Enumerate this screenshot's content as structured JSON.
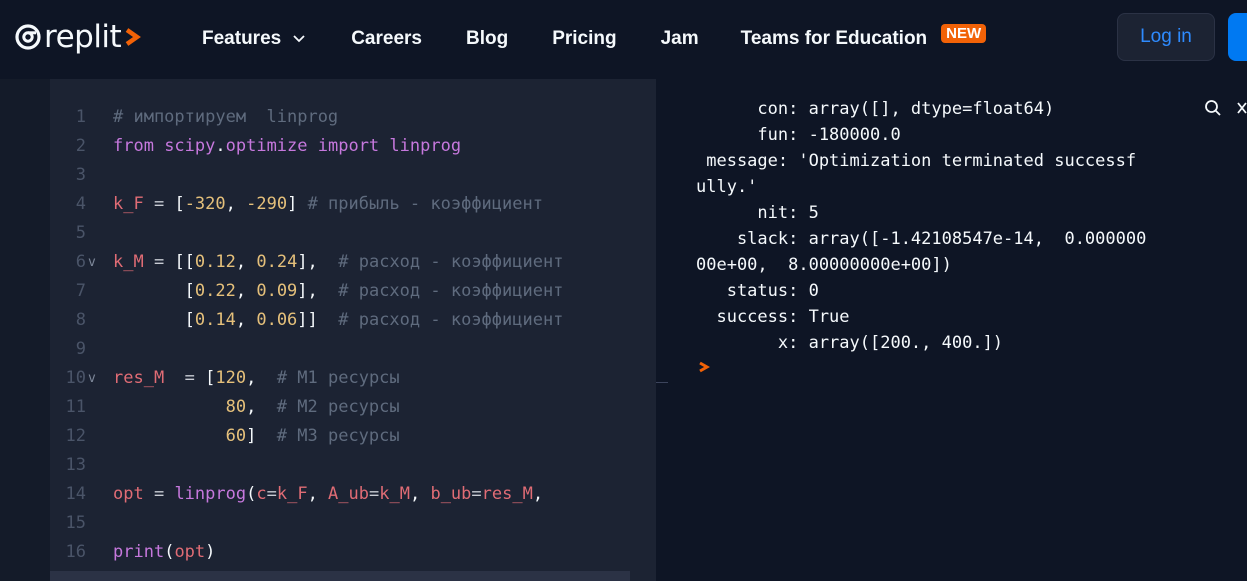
{
  "brand": {
    "name": "replit",
    "colors": {
      "accent_orange": "#f26207",
      "link_blue": "#2e8bff",
      "primary_blue": "#0079f2",
      "bg": "#0e1525"
    }
  },
  "nav": {
    "links": [
      "Features",
      "Careers",
      "Blog",
      "Pricing",
      "Jam",
      "Teams for Education"
    ],
    "badge": "NEW",
    "login": "Log in"
  },
  "editor": {
    "line_numbers": [
      "1",
      "2",
      "3",
      "4",
      "5",
      "6",
      "7",
      "8",
      "9",
      "10",
      "11",
      "12",
      "13",
      "14",
      "15",
      "16"
    ],
    "lines": [
      [
        [
          "com",
          "# импортируем  linprog"
        ]
      ],
      [
        [
          "kw",
          "from "
        ],
        [
          "mod",
          "scipy"
        ],
        [
          "pun",
          "."
        ],
        [
          "mod",
          "optimize"
        ],
        [
          "kw",
          " import "
        ],
        [
          "mod",
          "linprog"
        ]
      ],
      [],
      [
        [
          "var",
          "k_F"
        ],
        [
          "op",
          " = "
        ],
        [
          "pun",
          "["
        ],
        [
          "num",
          "-320"
        ],
        [
          "pun",
          ", "
        ],
        [
          "num",
          "-290"
        ],
        [
          "pun",
          "]"
        ],
        [
          "com",
          " # прибыль - коэффициент"
        ]
      ],
      [],
      [
        [
          "var",
          "k_M"
        ],
        [
          "op",
          " = "
        ],
        [
          "pun",
          "[["
        ],
        [
          "num",
          "0.12"
        ],
        [
          "pun",
          ", "
        ],
        [
          "num",
          "0.24"
        ],
        [
          "pun",
          "],"
        ],
        [
          "com",
          "  # расход - коэффициент"
        ]
      ],
      [
        [
          "plain",
          "       "
        ],
        [
          "pun",
          "["
        ],
        [
          "num",
          "0.22"
        ],
        [
          "pun",
          ", "
        ],
        [
          "num",
          "0.09"
        ],
        [
          "pun",
          "],"
        ],
        [
          "com",
          "  # расход - коэффициент"
        ]
      ],
      [
        [
          "plain",
          "       "
        ],
        [
          "pun",
          "["
        ],
        [
          "num",
          "0.14"
        ],
        [
          "pun",
          ", "
        ],
        [
          "num",
          "0.06"
        ],
        [
          "pun",
          "]]"
        ],
        [
          "com",
          "  # расход - коэффициент"
        ]
      ],
      [],
      [
        [
          "var",
          "res_M"
        ],
        [
          "op",
          "  = "
        ],
        [
          "pun",
          "["
        ],
        [
          "num",
          "120"
        ],
        [
          "pun",
          ","
        ],
        [
          "com",
          "  # M1 ресурсы"
        ]
      ],
      [
        [
          "plain",
          "           "
        ],
        [
          "num",
          "80"
        ],
        [
          "pun",
          ","
        ],
        [
          "com",
          "  # M2 ресурсы"
        ]
      ],
      [
        [
          "plain",
          "           "
        ],
        [
          "num",
          "60"
        ],
        [
          "pun",
          "]"
        ],
        [
          "com",
          "  # M3 ресурсы"
        ]
      ],
      [],
      [
        [
          "var",
          "opt"
        ],
        [
          "op",
          " = "
        ],
        [
          "fn",
          "linprog"
        ],
        [
          "pun",
          "("
        ],
        [
          "attr",
          "c"
        ],
        [
          "op",
          "="
        ],
        [
          "var",
          "k_F"
        ],
        [
          "pun",
          ", "
        ],
        [
          "attr",
          "A_ub"
        ],
        [
          "op",
          "="
        ],
        [
          "var",
          "k_M"
        ],
        [
          "pun",
          ", "
        ],
        [
          "attr",
          "b_ub"
        ],
        [
          "op",
          "="
        ],
        [
          "var",
          "res_M"
        ],
        [
          "pun",
          ","
        ]
      ],
      [],
      [
        [
          "fn",
          "print"
        ],
        [
          "pun",
          "("
        ],
        [
          "var",
          "opt"
        ],
        [
          "pun",
          ")"
        ]
      ]
    ],
    "fold_markers": {
      "6": "v",
      "10": "v"
    }
  },
  "console": {
    "output": [
      "      con: array([], dtype=float64)",
      "      fun: -180000.0",
      " message: 'Optimization terminated successf",
      "ully.'",
      "      nit: 5",
      "    slack: array([-1.42108547e-14,  0.000000",
      "00e+00,  8.00000000e+00])",
      "   status: 0",
      "  success: True",
      "        x: array([200., 400.])"
    ]
  }
}
